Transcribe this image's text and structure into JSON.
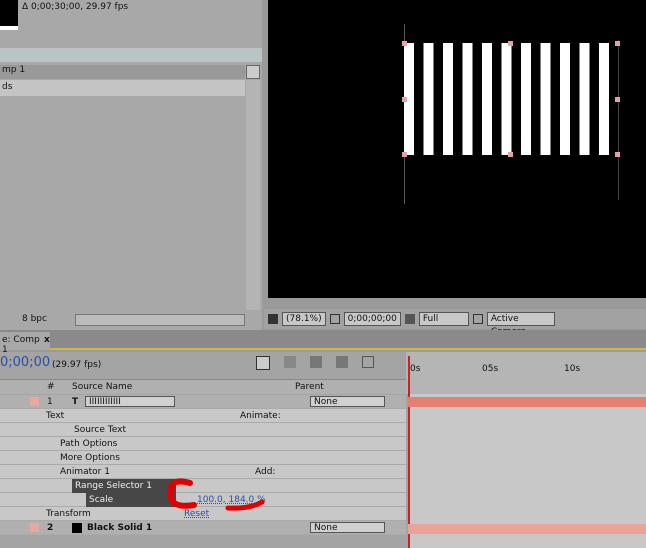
{
  "project": {
    "duration": "Δ 0;00;30;00, 29.97 fps",
    "item_header": "mp 1",
    "item": "ds",
    "bpc": "8 bpc"
  },
  "viewer": {
    "zoom": "(78.1%)",
    "timecode": "0;00;00;00",
    "resolution": "Full",
    "view": "Active Camera"
  },
  "timeline": {
    "tab": "e: Comp 1",
    "close": "x",
    "timecode": "0;00;00",
    "fps": "(29.97 fps)",
    "columns": {
      "num": "#",
      "source": "Source Name",
      "parent": "Parent"
    },
    "ruler": [
      "0s",
      "05s",
      "10s"
    ],
    "layers": [
      {
        "num": "1",
        "type": "T",
        "name": "IIIIIIIIIIII",
        "parent": "None"
      },
      {
        "num": "2",
        "name": "Black Solid 1",
        "parent": "None"
      }
    ],
    "props": {
      "text": "Text",
      "animate": "Animate:",
      "source_text": "Source Text",
      "path_options": "Path Options",
      "more_options": "More Options",
      "animator": "Animator 1",
      "add": "Add:",
      "range_selector": "Range Selector 1",
      "scale": "Scale",
      "scale_value": "100.0, 184.0 %",
      "transform": "Transform",
      "reset": "Reset"
    }
  },
  "colors": {
    "layer_bar": "#e3806f",
    "annotation": "#e00000",
    "tab_highlight": "#d3b540"
  }
}
